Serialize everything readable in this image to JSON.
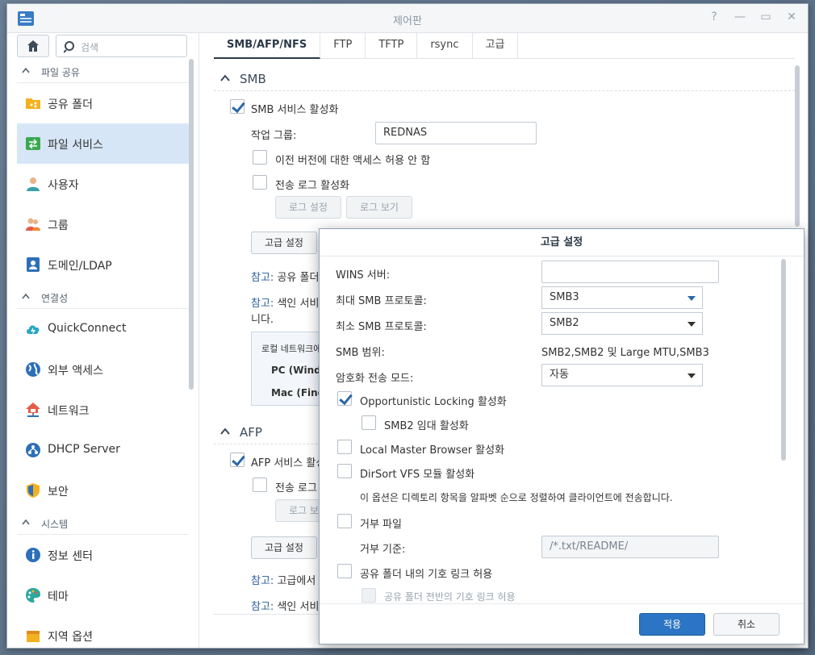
{
  "window": {
    "title": "제어판"
  },
  "sidebar": {
    "search_placeholder": "검색",
    "sections": [
      {
        "label": "파일 공유"
      },
      {
        "label": "연결성"
      },
      {
        "label": "시스템"
      }
    ],
    "items": [
      {
        "label": "공유 폴더"
      },
      {
        "label": "파일 서비스"
      },
      {
        "label": "사용자"
      },
      {
        "label": "그룹"
      },
      {
        "label": "도메인/LDAP"
      },
      {
        "label": "QuickConnect"
      },
      {
        "label": "외부 액세스"
      },
      {
        "label": "네트워크"
      },
      {
        "label": "DHCP Server"
      },
      {
        "label": "보안"
      },
      {
        "label": "정보 센터"
      },
      {
        "label": "테마"
      },
      {
        "label": "지역 옵션"
      }
    ]
  },
  "tabs": [
    "SMB/AFP/NFS",
    "FTP",
    "TFTP",
    "rsync",
    "고급"
  ],
  "smb": {
    "title": "SMB",
    "enable_label": "SMB 서비스 활성화",
    "workgroup_label": "작업 그룹:",
    "workgroup_value": "REDNAS",
    "prev_version_label": "이전 버전에 대한 액세스 허용 안 함",
    "transfer_log_label": "전송 로그 활성화",
    "log_settings": "로그 설정",
    "log_view": "로그 보기",
    "advanced_button": "고급 설정",
    "note1_prefix": "참고:",
    "note1_text": "공유 폴더의",
    "note2_prefix": "참고:",
    "note2_text": "색인 서비스",
    "note2_cont": "니다.",
    "info_title": "로컬 네트워크에",
    "info_pc": "PC (Window",
    "info_mac": "Mac (Finde"
  },
  "afp": {
    "title": "AFP",
    "enable_label": "AFP 서비스 활성화",
    "transfer_log_label": "전송 로그 활",
    "log_view": "로그 보기",
    "advanced_button": "고급 설정",
    "note1_prefix": "참고:",
    "note1_text": "고급에서 B",
    "note2_prefix": "참고:",
    "note2_text": "색인 서비스"
  },
  "dialog": {
    "title": "고급 설정",
    "wins_label": "WINS 서버:",
    "wins_value": "",
    "max_smb_label": "최대 SMB 프로토콜:",
    "max_smb_value": "SMB3",
    "min_smb_label": "최소 SMB 프로토콜:",
    "min_smb_value": "SMB2",
    "smb_range_label": "SMB 범위:",
    "smb_range_value": "SMB2,SMB2 및 Large MTU,SMB3",
    "encrypt_label": "암호화 전송 모드:",
    "encrypt_value": "자동",
    "oplock_label": "Opportunistic Locking 활성화",
    "smb2_lease_label": "SMB2 임대 활성화",
    "local_master_label": "Local Master Browser 활성화",
    "dirsort_label": "DirSort VFS 모듈 활성화",
    "dirsort_desc": "이 옵션은 디렉토리 항목을 알파벳 순으로 정렬하여 클라이언트에 전송합니다.",
    "veto_label": "거부 파일",
    "veto_criteria_label": "거부 기준:",
    "veto_criteria_value": "/*.txt/README/",
    "symlink_label": "공유 폴더 내의 기호 링크 허용",
    "symlink_cross_label": "공유 폴더 전반의 기호 링크 허용",
    "apply": "적용",
    "cancel": "취소"
  },
  "colors": {
    "accent": "#2c74c4",
    "active_item": "#d7e6f6"
  }
}
